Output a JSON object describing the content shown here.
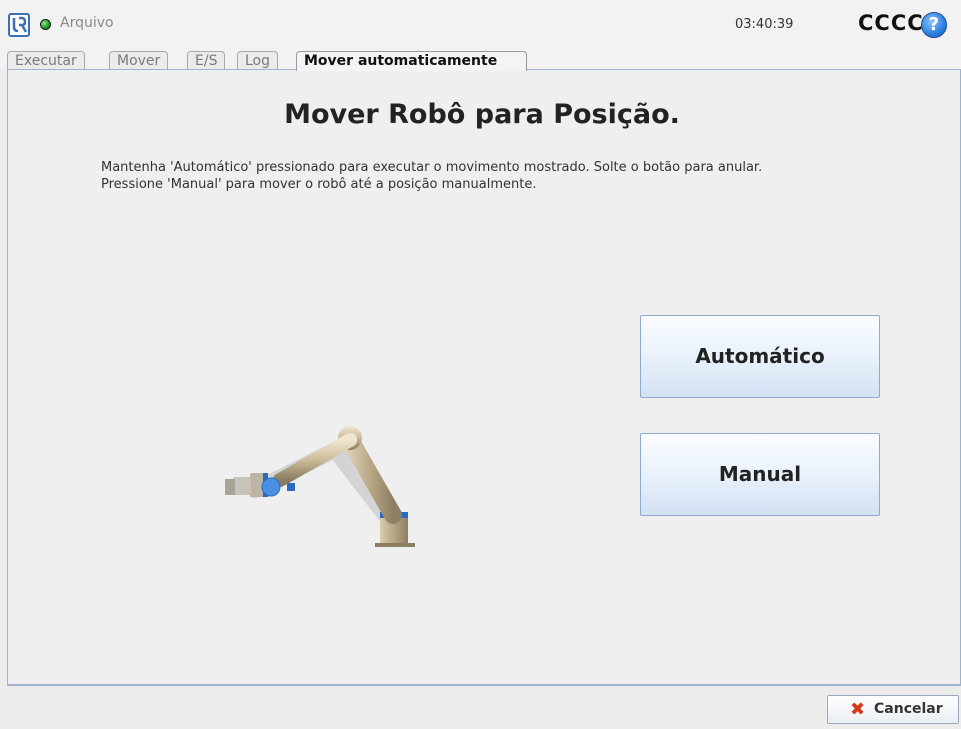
{
  "header": {
    "logo_icon": "ur-logo-icon",
    "status_color": "#1c9a1c",
    "file_menu": "Arquivo",
    "clock": "03:40:39",
    "robot_name": "CCCC",
    "help_symbol": "?"
  },
  "tabs": [
    {
      "label": "Executar",
      "active": false
    },
    {
      "label": "Mover",
      "active": false
    },
    {
      "label": "E/S",
      "active": false
    },
    {
      "label": "Log",
      "active": false
    },
    {
      "label": "Mover automaticamente",
      "active": true
    }
  ],
  "main": {
    "title": "Mover Robô para Posição.",
    "instruction_line1": "Mantenha 'Automático' pressionado para executar o movimento mostrado. Solte o botão para anular.",
    "instruction_line2": "Pressione 'Manual' para mover o robô até a posição manualmente.",
    "auto_button": "Automático",
    "manual_button": "Manual"
  },
  "footer": {
    "cancel_icon_char": "✖",
    "cancel_label": "Cancelar"
  },
  "colors": {
    "accent_border": "#8eaad0",
    "cancel_icon": "#d33a1a"
  }
}
